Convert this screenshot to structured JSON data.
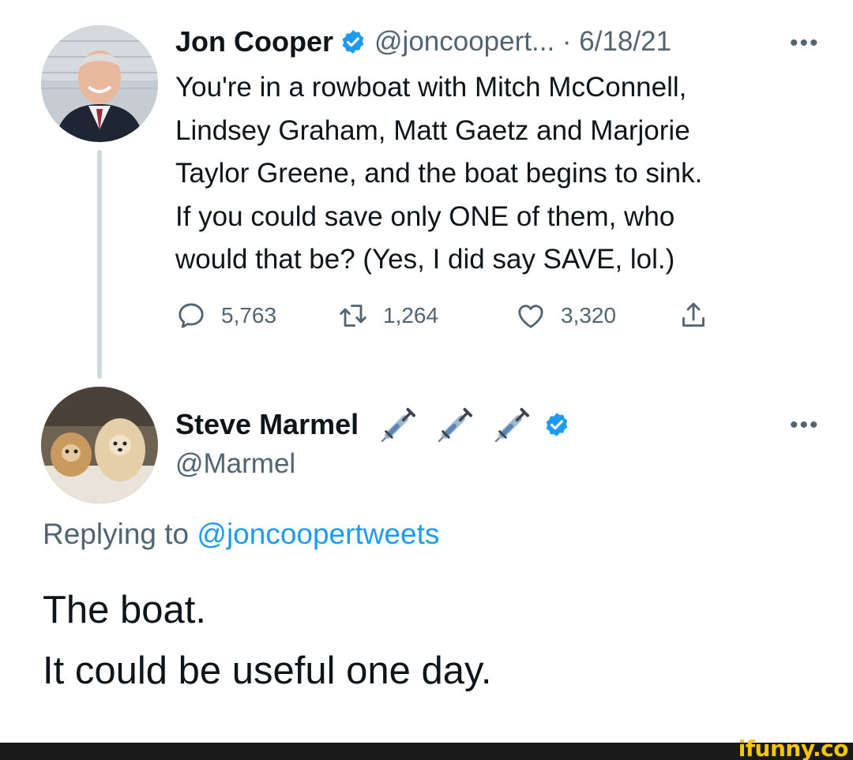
{
  "tweet1": {
    "display_name": "Jon Cooper",
    "handle_date": "@joncoopert... · 6/18/21",
    "more_label": "•••",
    "text_lines": [
      "You're in a rowboat with Mitch McConnell,",
      "Lindsey Graham, Matt Gaetz and Marjorie",
      "Taylor Greene, and the boat begins to sink.",
      "If you could save only ONE of them, who",
      "would that be? (Yes, I did say SAVE, lol.)"
    ],
    "replies": "5,763",
    "retweets": "1,264",
    "likes": "3,320",
    "icons": [
      "reply-icon",
      "retweet-icon",
      "like-icon",
      "share-icon",
      "verified-badge-icon"
    ]
  },
  "tweet2": {
    "display_name": "Steve Marmel",
    "handle": "@Marmel",
    "more_label": "•••",
    "name_emojis": [
      "syringe-icon",
      "syringe-icon",
      "syringe-icon"
    ],
    "replying_prefix": "Replying to",
    "replying_mention": "@joncoopertweets",
    "text_lines": [
      "The boat.",
      "It could be useful one day."
    ]
  },
  "watermark": "ifunny.co",
  "colors": {
    "text": "#0f1419",
    "secondary": "#536471",
    "verified": "#1d9bf0",
    "thread_line": "#cfd9de",
    "watermark": "#f6c600",
    "footer": "#1a1a1a"
  }
}
